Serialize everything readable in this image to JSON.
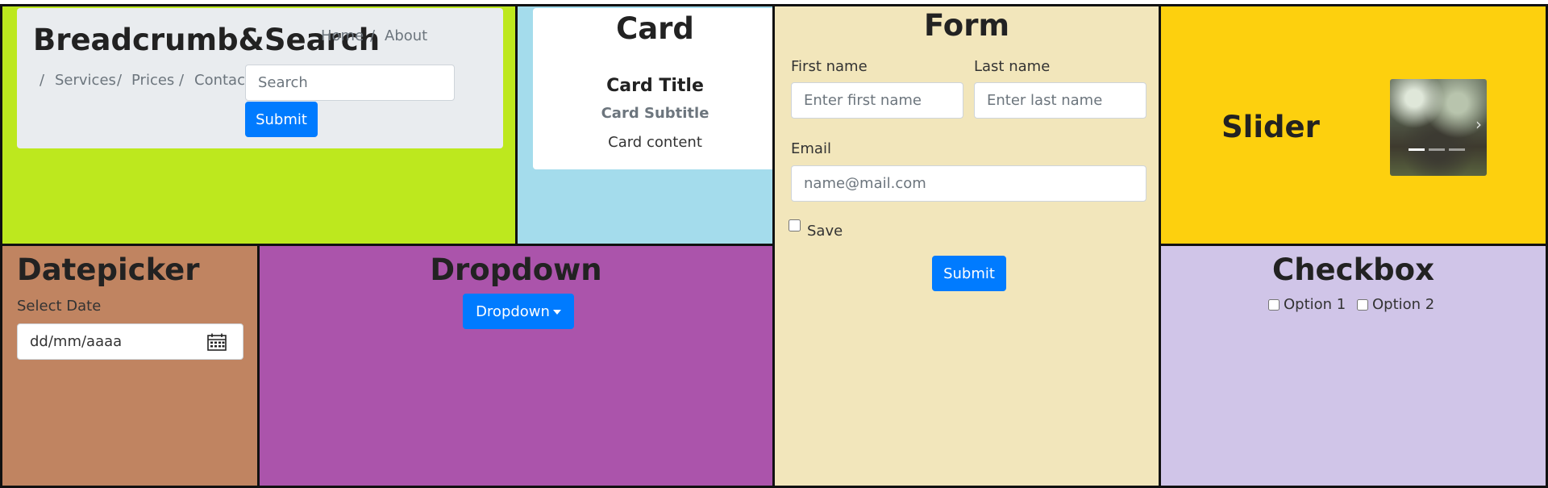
{
  "breadcrumb_section": {
    "title": "Breadcrumb&Search",
    "crumbs": [
      "Home",
      "About",
      "Services",
      "Prices",
      "Contact"
    ],
    "separator": "/",
    "search_placeholder": "Search",
    "submit_label": "Submit"
  },
  "card_section": {
    "heading": "Card",
    "card_title": "Card Title",
    "card_subtitle": "Card Subtitle",
    "card_content": "Card content"
  },
  "form_section": {
    "heading": "Form",
    "first_name_label": "First name",
    "first_name_placeholder": "Enter first name",
    "last_name_label": "Last name",
    "last_name_placeholder": "Enter last name",
    "email_label": "Email",
    "email_placeholder": "name@mail.com",
    "save_label": "Save",
    "submit_label": "Submit"
  },
  "slider_section": {
    "heading": "Slider",
    "slide_count": 3,
    "active_slide": 1
  },
  "datepicker_section": {
    "heading": "Datepicker",
    "label": "Select Date",
    "placeholder": "dd/mm/aaaa"
  },
  "dropdown_section": {
    "heading": "Dropdown",
    "button_label": "Dropdown"
  },
  "checkbox_section": {
    "heading": "Checkbox",
    "options": [
      "Option 1",
      "Option 2"
    ]
  },
  "colors": {
    "breadcrumb_bg": "#bde81e",
    "card_bg": "#a4dcec",
    "form_bg": "#f2e6bb",
    "slider_bg": "#fdd00e",
    "datepicker_bg": "#c08461",
    "dropdown_bg": "#ab54ab",
    "checkbox_bg": "#d0c5e8",
    "primary": "#007bff"
  }
}
